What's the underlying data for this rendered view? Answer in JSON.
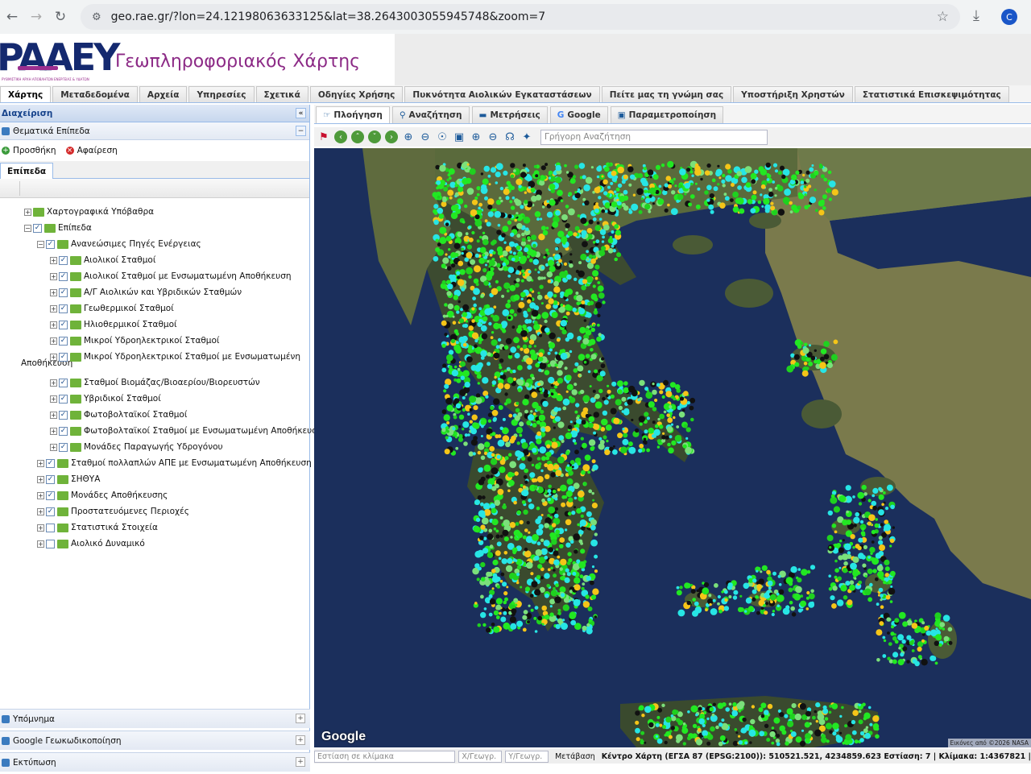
{
  "browser": {
    "url": "geo.rae.gr/?lon=24.12198063633125&lat=38.2643003055945748&zoom=7",
    "avatar_letter": "C"
  },
  "header": {
    "logo_text": "PAAEY",
    "logo_tagline": "ΡΥΘΜΙΣΤΙΚΗ ΑΡΧΗ ΑΠΟΒΛΗΤΩΝ ΕΝΕΡΓΕΙΑΣ & ΥΔΑΤΩΝ",
    "title": "Γεωπληροφοριακός Χάρτης"
  },
  "main_tabs": [
    "Χάρτης",
    "Μεταδεδομένα",
    "Αρχεία",
    "Υπηρεσίες",
    "Σχετικά",
    "Οδηγίες Χρήσης",
    "Πυκνότητα Αιολικών Εγκαταστάσεων",
    "Πείτε μας τη γνώμη σας",
    "Υποστήριξη Χρηστών",
    "Στατιστικά Επισκεψιμότητας"
  ],
  "left": {
    "panel_title": "Διαχείριση",
    "thematic": "Θεματικά Επίπεδα",
    "add": "Προσθήκη",
    "remove": "Αφαίρεση",
    "layers_tab": "Επίπεδα",
    "tree": [
      {
        "label": "Χαρτογραφικά Υπόβαθρα",
        "checked": false,
        "hasCb": false
      },
      {
        "label": "Επίπεδα",
        "checked": true,
        "hasCb": true
      },
      {
        "label": "Ανανεώσιμες Πηγές Ενέργειας",
        "checked": true,
        "hasCb": true
      },
      {
        "label": "Αιολικοί Σταθμοί",
        "checked": true,
        "hasCb": true
      },
      {
        "label": "Αιολικοί Σταθμοί με Ενσωματωμένη Αποθήκευση",
        "checked": true,
        "hasCb": true
      },
      {
        "label": "Α/Γ Αιολικών και Υβριδικών Σταθμών",
        "checked": true,
        "hasCb": true
      },
      {
        "label": "Γεωθερμικοί Σταθμοί",
        "checked": true,
        "hasCb": true
      },
      {
        "label": "Ηλιοθερμικοί Σταθμοί",
        "checked": true,
        "hasCb": true
      },
      {
        "label": "Μικροί Υδροηλεκτρικοί Σταθμοί",
        "checked": true,
        "hasCb": true
      },
      {
        "label": "Μικροί Υδροηλεκτρικοί Σταθμοί με Ενσωματωμένη",
        "checked": true,
        "hasCb": true
      },
      {
        "label": "Σταθμοί Βιομάζας/Βιοαερίου/Βιορευστών",
        "checked": true,
        "hasCb": true
      },
      {
        "label": "Υβριδικοί Σταθμοί",
        "checked": true,
        "hasCb": true
      },
      {
        "label": "Φωτοβολταϊκοί Σταθμοί",
        "checked": true,
        "hasCb": true
      },
      {
        "label": "Φωτοβολταϊκοί Σταθμοί με Ενσωματωμένη Αποθήκευση",
        "checked": true,
        "hasCb": true
      },
      {
        "label": "Μονάδες Παραγωγής Υδρογόνου",
        "checked": true,
        "hasCb": true
      },
      {
        "label": "Σταθμοί πολλαπλών ΑΠΕ με Ενσωματωμένη Αποθήκευση",
        "checked": true,
        "hasCb": true
      },
      {
        "label": "ΣΗΘΥΑ",
        "checked": true,
        "hasCb": true
      },
      {
        "label": "Μονάδες Αποθήκευσης",
        "checked": true,
        "hasCb": true
      },
      {
        "label": "Προστατευόμενες Περιοχές",
        "checked": true,
        "hasCb": true
      },
      {
        "label": "Στατιστικά Στοιχεία",
        "checked": false,
        "hasCb": true
      },
      {
        "label": "Αιολικό Δυναμικό",
        "checked": false,
        "hasCb": true
      }
    ],
    "wrap_text": "Αποθήκευση",
    "bottom": [
      "Υπόμνημα",
      "Google Γεωκωδικοποίηση",
      "Εκτύπωση"
    ]
  },
  "map_tabs": [
    "Πλοήγηση",
    "Αναζήτηση",
    "Μετρήσεις",
    "Google",
    "Παραμετροποίηση"
  ],
  "search_placeholder": "Γρήγορη Αναζήτηση",
  "map": {
    "google": "Google",
    "attribution": "Εικόνες από ©2026 NASA"
  },
  "status": {
    "scale_placeholder": "Εστίαση σε κλίμακα",
    "x_placeholder": "Χ/Γεωγρ.",
    "y_placeholder": "Υ/Γεωγρ.",
    "go": "Μετάβαση",
    "center": "Κέντρο Χάρτη (ΕΓΣΑ 87 (EPSG:2100)): 510521.521, 4234859.623 Εστίαση: 7 | Κλίμακα: 1:4367821 |"
  }
}
